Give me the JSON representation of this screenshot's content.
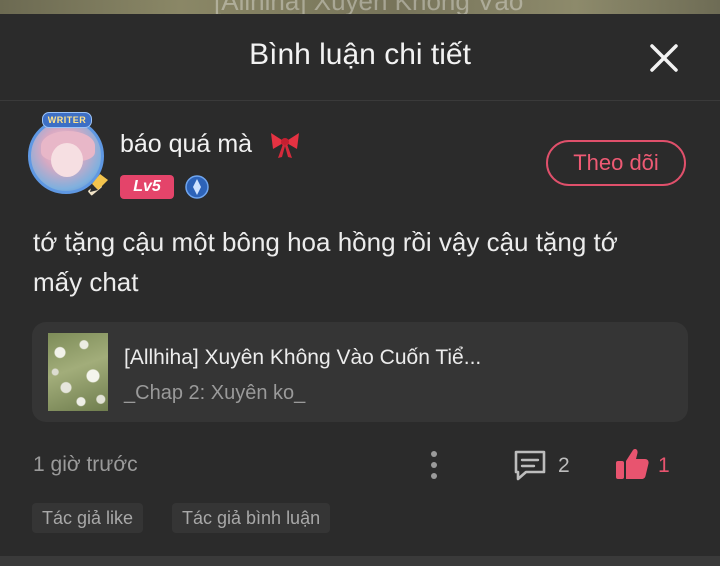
{
  "background_title_text": "[Allhiha] Xuyên Không Vào",
  "header": {
    "title": "Bình luận chi tiết",
    "close_icon": "close-icon"
  },
  "comment": {
    "avatar_frame_label": "WRITER",
    "username": "báo quá mà",
    "username_emoji": "bow-icon",
    "level": "Lv5",
    "rank_icon": "rank-badge-icon",
    "follow_label": "Theo dõi",
    "text": "tớ tặng cậu một bông hoa hồng rồi vậy cậu tặng tớ mấy chat",
    "chapter_card": {
      "title": "[Allhiha] Xuyên Không Vào Cuốn Tiể...",
      "subtitle": "_Chap 2: Xuyên ko_"
    },
    "time": "1 giờ trước",
    "reply_count": "2",
    "like_count": "1",
    "tags": [
      "Tác giả like",
      "Tác giả bình luận"
    ]
  },
  "colors": {
    "background": "#2b2b2b",
    "accent": "#e8546f",
    "level_badge": "#e4446a",
    "card": "#353535"
  }
}
